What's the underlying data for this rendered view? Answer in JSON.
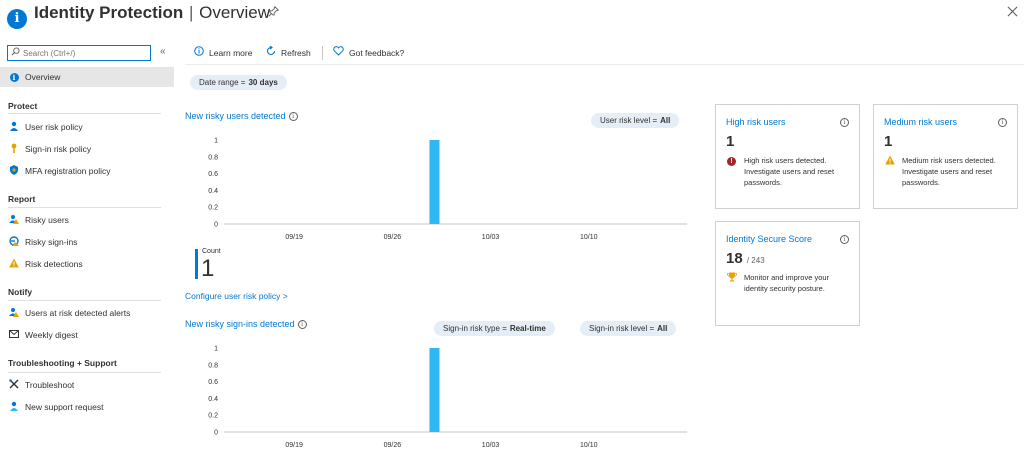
{
  "header": {
    "title_main": "Identity Protection",
    "separator": "|",
    "title_sub": "Overview",
    "pin_icon": "pin-icon",
    "close_icon": "close-icon"
  },
  "sidebar": {
    "search_placeholder": "Search (Ctrl+/)",
    "collapse_glyph": "«",
    "overview": "Overview",
    "sections": [
      {
        "title": "Protect",
        "items": [
          "User risk policy",
          "Sign-in risk policy",
          "MFA registration policy"
        ]
      },
      {
        "title": "Report",
        "items": [
          "Risky users",
          "Risky sign-ins",
          "Risk detections"
        ]
      },
      {
        "title": "Notify",
        "items": [
          "Users at risk detected alerts",
          "Weekly digest"
        ]
      },
      {
        "title": "Troubleshooting + Support",
        "items": [
          "Troubleshoot",
          "New support request"
        ]
      }
    ]
  },
  "toolbar": {
    "learn_more": "Learn more",
    "refresh": "Refresh",
    "feedback": "Got feedback?"
  },
  "date_range": {
    "label": "Date range =",
    "value": "30 days"
  },
  "users_chart_section": {
    "title": "New risky users detected",
    "filter_label": "User risk level =",
    "filter_value": "All",
    "count_label": "Count",
    "count_value": "1",
    "link": "Configure user risk policy >"
  },
  "signins_chart_section": {
    "title": "New risky sign-ins detected",
    "filter1_label": "Sign-in risk type =",
    "filter1_value": "Real-time",
    "filter2_label": "Sign-in risk level =",
    "filter2_value": "All"
  },
  "cards": {
    "high": {
      "title": "High risk users",
      "value": "1",
      "desc": "High risk users detected. Investigate users and reset passwords."
    },
    "medium": {
      "title": "Medium risk users",
      "value": "1",
      "desc": "Medium risk users detected. Investigate users and reset passwords."
    },
    "secure": {
      "title": "Identity Secure Score",
      "value": "18",
      "total": "/ 243",
      "desc": "Monitor and improve your identity security posture."
    }
  },
  "colors": {
    "accent": "#0078d4",
    "bar": "#2eb7f0",
    "danger": "#a4262c",
    "warning": "#e8a200"
  },
  "chart_data": [
    {
      "type": "bar",
      "title": "New risky users detected",
      "x_ticks": [
        "09/19",
        "09/26",
        "10/03",
        "10/10"
      ],
      "y_ticks": [
        "1",
        "0.8",
        "0.6",
        "0.4",
        "0.2",
        "0"
      ],
      "ylim": [
        0,
        1
      ],
      "x_day_range": [
        0,
        33
      ],
      "tick_days": [
        5,
        12,
        19,
        26
      ],
      "values": [
        {
          "x": "09/29",
          "day": 15,
          "y": 1
        }
      ],
      "grid": false
    },
    {
      "type": "bar",
      "title": "New risky sign-ins detected",
      "x_ticks": [
        "09/19",
        "09/26",
        "10/03",
        "10/10"
      ],
      "y_ticks": [
        "1",
        "0.8",
        "0.6",
        "0.4",
        "0.2",
        "0"
      ],
      "ylim": [
        0,
        1
      ],
      "x_day_range": [
        0,
        33
      ],
      "tick_days": [
        5,
        12,
        19,
        26
      ],
      "values": [
        {
          "x": "09/29",
          "day": 15,
          "y": 1
        }
      ],
      "grid": false
    }
  ]
}
